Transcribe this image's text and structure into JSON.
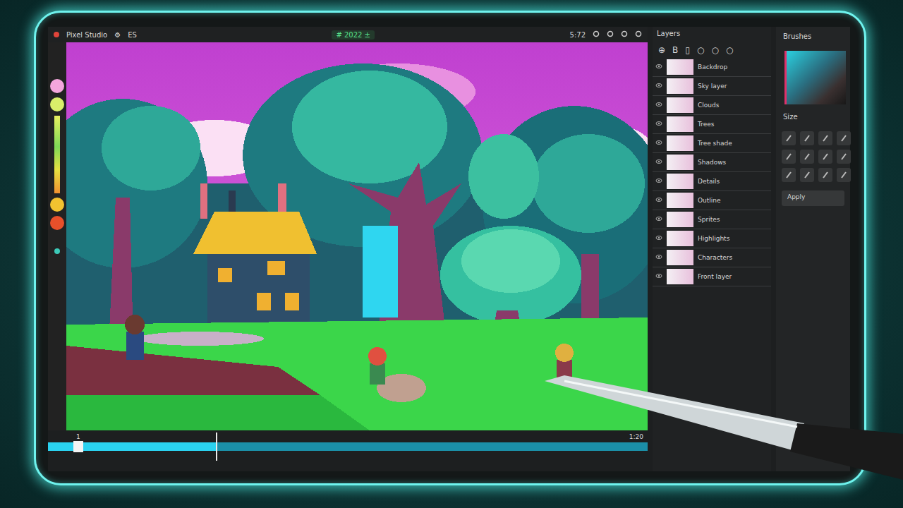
{
  "window": {
    "title": "Pixel Studio",
    "menu": [
      "⚙",
      "ES"
    ]
  },
  "frame_counter": "# 2022 ±",
  "zoom": "5:72",
  "palette": [
    {
      "kind": "dot",
      "color": "#f4a6dc"
    },
    {
      "kind": "dot",
      "color": "#d9ee6a"
    },
    {
      "kind": "bar",
      "color": "#7ed957"
    },
    {
      "kind": "dot",
      "color": "#f2c230"
    },
    {
      "kind": "dot",
      "color": "#e8502a"
    },
    {
      "kind": "small",
      "color": "#3cc9b8"
    }
  ],
  "layers": {
    "title": "Layers",
    "tools": [
      "⊕",
      "B",
      "▯",
      "○",
      "○",
      "○"
    ],
    "items": [
      {
        "name": "Backdrop"
      },
      {
        "name": "Sky layer"
      },
      {
        "name": "Clouds"
      },
      {
        "name": "Trees"
      },
      {
        "name": "Tree shade"
      },
      {
        "name": "Shadows"
      },
      {
        "name": "Details"
      },
      {
        "name": "Outline"
      },
      {
        "name": "Sprites"
      },
      {
        "name": "Highlights"
      },
      {
        "name": "Characters"
      },
      {
        "name": "Front layer"
      }
    ]
  },
  "brush_panel": {
    "title": "Brushes",
    "section": "Size",
    "button": "Apply"
  },
  "timeline": {
    "start": "1",
    "end": "1:20",
    "level": 0.28
  }
}
